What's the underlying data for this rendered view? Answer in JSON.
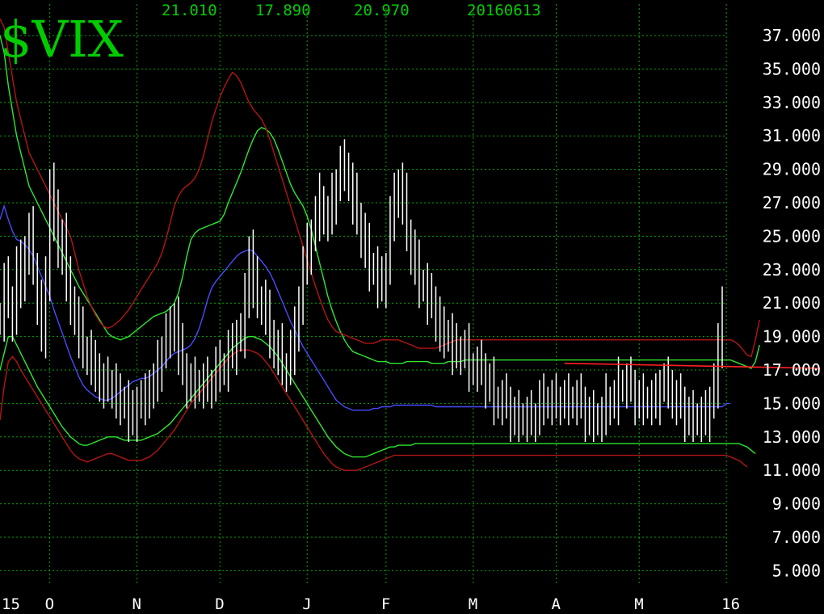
{
  "header": {
    "symbol": "$VIX",
    "high": "21.010",
    "low": "17.890",
    "close": "20.970",
    "date": "20160613"
  },
  "colors": {
    "background": "#000000",
    "grid": "#00aa00",
    "price": "#ffffff",
    "ma": "#4a4aff",
    "band_inner": "#2ee82e",
    "band_outer": "#b31515",
    "trendline": "#ff2020",
    "header_text": "#00cc00",
    "axis_text": "#ffffff"
  },
  "chart_data": {
    "type": "line",
    "title": "$VIX",
    "ylim": [
      5,
      38
    ],
    "y_ticks": [
      "37.000",
      "35.000",
      "33.000",
      "31.000",
      "29.000",
      "27.000",
      "25.000",
      "23.000",
      "21.000",
      "19.000",
      "17.000",
      "15.000",
      "13.000",
      "11.000",
      "9.000",
      "7.000",
      "5.000"
    ],
    "y_tick_values": [
      37,
      35,
      33,
      31,
      29,
      27,
      25,
      23,
      21,
      19,
      17,
      15,
      13,
      11,
      9,
      7,
      5
    ],
    "x_ticks": [
      "15",
      "O",
      "N",
      "D",
      "J",
      "F",
      "M",
      "A",
      "M",
      "16"
    ],
    "x_tick_index": [
      0,
      12,
      33,
      53,
      74,
      93,
      114,
      134,
      154,
      175
    ],
    "grid": true,
    "series": [
      {
        "style": "price",
        "values": [
          20,
          22,
          21,
          20,
          23,
          22,
          24,
          25,
          23,
          21,
          19,
          22,
          28,
          26,
          24,
          25,
          22,
          21,
          20,
          19,
          18,
          18,
          17,
          17,
          16,
          16,
          16,
          16,
          15,
          15,
          15,
          14,
          14,
          15,
          15,
          15,
          16,
          16,
          17,
          18,
          19,
          19,
          20,
          18,
          17,
          16,
          16,
          16,
          16,
          16,
          16,
          16,
          17,
          17,
          17,
          18,
          18,
          19,
          19,
          21,
          24,
          22,
          21,
          21,
          20,
          19,
          18,
          18,
          17,
          17,
          18,
          19,
          21,
          23,
          24,
          25,
          26,
          27,
          26,
          26,
          27,
          28,
          29,
          29,
          28,
          27,
          26,
          25,
          24,
          23,
          23,
          22,
          22,
          23,
          26,
          27,
          28,
          27,
          25,
          24,
          23,
          22,
          22,
          21,
          21,
          20,
          19,
          19,
          19,
          18,
          18,
          18,
          18,
          17,
          17,
          17,
          17,
          16,
          16,
          15,
          15,
          15,
          15,
          14,
          14,
          14,
          14,
          14,
          14,
          14,
          15,
          15,
          15,
          15,
          15,
          15,
          15,
          15,
          15,
          15,
          15,
          14,
          14,
          14,
          14,
          14,
          15,
          15,
          15,
          16,
          16,
          16,
          16,
          15,
          15,
          15,
          15,
          15,
          15,
          16,
          16,
          16,
          15,
          15,
          15,
          14,
          14,
          14,
          14,
          14,
          14,
          15,
          16,
          18,
          21
        ]
      },
      {
        "style": "ma",
        "values": [
          26,
          26.8,
          26,
          25.3,
          24.8,
          24.7,
          24.5,
          24.2,
          23.8,
          23.2,
          22.6,
          22,
          21.4,
          20.6,
          19.9,
          19.2,
          18.5,
          17.8,
          17.2,
          16.6,
          16.1,
          15.8,
          15.6,
          15.4,
          15.3,
          15.2,
          15.2,
          15.3,
          15.5,
          15.7,
          15.9,
          16.1,
          16.3,
          16.4,
          16.5,
          16.5,
          16.6,
          16.8,
          17,
          17.2,
          17.5,
          17.8,
          18,
          18.1,
          18.2,
          18.3,
          18.5,
          18.9,
          19.5,
          20.3,
          21.2,
          21.9,
          22.3,
          22.6,
          22.9,
          23.2,
          23.5,
          23.8,
          24,
          24.1,
          24.2,
          24.1,
          23.8,
          23.5,
          23.2,
          22.8,
          22.3,
          21.7,
          21.1,
          20.5,
          19.9,
          19.4,
          18.9,
          18.4,
          18,
          17.6,
          17.2,
          16.8,
          16.4,
          16,
          15.6,
          15.2,
          15,
          14.8,
          14.7,
          14.6,
          14.6,
          14.6,
          14.6,
          14.6,
          14.7,
          14.7,
          14.8,
          14.8,
          14.8,
          14.9,
          14.9,
          14.9,
          14.9,
          14.9,
          14.9,
          14.9,
          14.9,
          14.9,
          14.9,
          14.8,
          14.8,
          14.8,
          14.8,
          14.8,
          14.8,
          14.8,
          14.8,
          14.8,
          14.8,
          14.8,
          14.8,
          14.8,
          14.8,
          14.8,
          14.8,
          14.8,
          14.8,
          14.8,
          14.8,
          14.8,
          14.8,
          14.8,
          14.8,
          14.8,
          14.8,
          14.8,
          14.8,
          14.8,
          14.8,
          14.8,
          14.8,
          14.8,
          14.8,
          14.8,
          14.8,
          14.8,
          14.8,
          14.8,
          14.8,
          14.8,
          14.8,
          14.8,
          14.8,
          14.8,
          14.8,
          14.8,
          14.8,
          14.8,
          14.8,
          14.8,
          14.8,
          14.8,
          14.8,
          14.8,
          14.8,
          14.8,
          14.8,
          14.8,
          14.8,
          14.8,
          14.8,
          14.8,
          14.8,
          14.8,
          14.8,
          14.8,
          14.8,
          14.8,
          14.8,
          15,
          15
        ]
      },
      {
        "style": "band_inner_upper",
        "values": [
          37,
          36,
          34,
          32.5,
          31,
          30,
          29,
          28,
          27.5,
          27,
          26.5,
          26,
          25.5,
          25,
          24.5,
          24,
          23.5,
          23,
          22.5,
          22,
          21.6,
          21.2,
          20.8,
          20.4,
          20,
          19.6,
          19.2,
          19,
          18.9,
          18.8,
          18.9,
          19,
          19.2,
          19.4,
          19.6,
          19.8,
          20,
          20.2,
          20.3,
          20.4,
          20.5,
          20.7,
          21,
          21.6,
          22.6,
          23.8,
          24.8,
          25.2,
          25.4,
          25.5,
          25.6,
          25.7,
          25.8,
          25.9,
          26.3,
          27,
          27.6,
          28.2,
          28.8,
          29.5,
          30.2,
          30.8,
          31.3,
          31.5,
          31.4,
          31.2,
          30.8,
          30.2,
          29.5,
          28.8,
          28.1,
          27.6,
          27.2,
          26.8,
          26.2,
          25.4,
          24.4,
          23.4,
          22.4,
          21.4,
          20.6,
          19.9,
          19.3,
          18.8,
          18.4,
          18.1,
          18,
          17.9,
          17.8,
          17.7,
          17.6,
          17.5,
          17.5,
          17.5,
          17.4,
          17.4,
          17.4,
          17.4,
          17.5,
          17.5,
          17.5,
          17.5,
          17.5,
          17.5,
          17.4,
          17.4,
          17.4,
          17.4,
          17.5,
          17.5,
          17.5,
          17.5,
          17.6,
          17.6,
          17.6,
          17.6,
          17.6,
          17.6,
          17.6,
          17.6,
          17.6,
          17.6,
          17.6,
          17.6,
          17.6,
          17.6,
          17.6,
          17.6,
          17.6,
          17.6,
          17.6,
          17.6,
          17.6,
          17.6,
          17.6,
          17.6,
          17.6,
          17.6,
          17.6,
          17.6,
          17.6,
          17.6,
          17.6,
          17.6,
          17.6,
          17.6,
          17.6,
          17.6,
          17.6,
          17.6,
          17.6,
          17.6,
          17.6,
          17.6,
          17.6,
          17.6,
          17.6,
          17.6,
          17.6,
          17.6,
          17.6,
          17.6,
          17.6,
          17.6,
          17.6,
          17.6,
          17.6,
          17.6,
          17.6,
          17.6,
          17.6,
          17.6,
          17.6,
          17.6,
          17.6,
          17.6,
          17.6,
          17.5,
          17.4,
          17.3,
          17.2,
          17.1,
          17.5,
          18.5
        ]
      },
      {
        "style": "band_inner_lower",
        "values": [
          17,
          18,
          19,
          19,
          18.5,
          18,
          17.5,
          17,
          16.5,
          16,
          15.6,
          15.2,
          14.8,
          14.4,
          14,
          13.6,
          13.3,
          13,
          12.8,
          12.6,
          12.5,
          12.5,
          12.6,
          12.7,
          12.8,
          12.9,
          13,
          13,
          13,
          12.9,
          12.8,
          12.8,
          12.8,
          12.8,
          12.8,
          12.9,
          13,
          13.1,
          13.2,
          13.4,
          13.6,
          13.8,
          14.1,
          14.4,
          14.7,
          15,
          15.3,
          15.6,
          15.9,
          16.2,
          16.5,
          16.8,
          17.1,
          17.4,
          17.7,
          18,
          18.3,
          18.5,
          18.7,
          18.9,
          19,
          19,
          18.9,
          18.8,
          18.6,
          18.4,
          18.1,
          17.8,
          17.4,
          17,
          16.6,
          16.2,
          15.8,
          15.4,
          15,
          14.6,
          14.2,
          13.8,
          13.4,
          13,
          12.7,
          12.4,
          12.2,
          12,
          11.9,
          11.8,
          11.8,
          11.8,
          11.8,
          11.9,
          12,
          12.1,
          12.2,
          12.3,
          12.4,
          12.4,
          12.5,
          12.5,
          12.5,
          12.5,
          12.6,
          12.6,
          12.6,
          12.6,
          12.6,
          12.6,
          12.6,
          12.6,
          12.6,
          12.6,
          12.6,
          12.6,
          12.6,
          12.6,
          12.6,
          12.6,
          12.6,
          12.6,
          12.6,
          12.6,
          12.6,
          12.6,
          12.6,
          12.6,
          12.6,
          12.6,
          12.6,
          12.6,
          12.6,
          12.6,
          12.6,
          12.6,
          12.6,
          12.6,
          12.6,
          12.6,
          12.6,
          12.6,
          12.6,
          12.6,
          12.6,
          12.6,
          12.6,
          12.6,
          12.6,
          12.6,
          12.6,
          12.6,
          12.6,
          12.6,
          12.6,
          12.6,
          12.6,
          12.6,
          12.6,
          12.6,
          12.6,
          12.6,
          12.6,
          12.6,
          12.6,
          12.6,
          12.6,
          12.6,
          12.6,
          12.6,
          12.6,
          12.6,
          12.6,
          12.6,
          12.6,
          12.6,
          12.6,
          12.6,
          12.6,
          12.6,
          12.6,
          12.6,
          12.6,
          12.5,
          12.4,
          12.2,
          12
        ]
      },
      {
        "style": "band_outer_upper",
        "values": [
          38,
          37.5,
          36,
          34.5,
          33,
          32,
          31,
          30,
          29.5,
          29,
          28.5,
          28,
          27.5,
          27,
          26.5,
          26,
          25.5,
          25,
          24,
          23,
          22.2,
          21.4,
          20.8,
          20.3,
          19.9,
          19.6,
          19.5,
          19.6,
          19.8,
          20,
          20.3,
          20.6,
          21,
          21.4,
          21.8,
          22.2,
          22.6,
          23,
          23.4,
          24,
          24.8,
          25.8,
          26.8,
          27.4,
          27.8,
          28,
          28.2,
          28.5,
          29,
          29.8,
          30.8,
          31.8,
          32.6,
          33.3,
          33.9,
          34.4,
          34.8,
          34.6,
          34.2,
          33.6,
          33,
          32.6,
          32.3,
          32,
          31.5,
          30.8,
          30,
          29.2,
          28.4,
          27.6,
          26.8,
          26,
          25.2,
          24.4,
          23.6,
          22.8,
          22,
          21.3,
          20.6,
          20,
          19.6,
          19.3,
          19.2,
          19.1,
          19,
          18.9,
          18.8,
          18.7,
          18.6,
          18.6,
          18.6,
          18.7,
          18.8,
          18.8,
          18.8,
          18.8,
          18.8,
          18.7,
          18.6,
          18.5,
          18.4,
          18.3,
          18.3,
          18.3,
          18.3,
          18.3,
          18.4,
          18.5,
          18.6,
          18.7,
          18.8,
          18.8,
          18.8,
          18.8,
          18.8,
          18.8,
          18.8,
          18.8,
          18.8,
          18.8,
          18.8,
          18.8,
          18.8,
          18.8,
          18.8,
          18.8,
          18.8,
          18.8,
          18.8,
          18.8,
          18.8,
          18.8,
          18.8,
          18.8,
          18.8,
          18.8,
          18.8,
          18.8,
          18.8,
          18.8,
          18.8,
          18.8,
          18.8,
          18.8,
          18.8,
          18.8,
          18.8,
          18.8,
          18.8,
          18.8,
          18.8,
          18.8,
          18.8,
          18.8,
          18.8,
          18.8,
          18.8,
          18.8,
          18.8,
          18.8,
          18.8,
          18.8,
          18.8,
          18.8,
          18.8,
          18.8,
          18.8,
          18.8,
          18.8,
          18.8,
          18.8,
          18.8,
          18.8,
          18.8,
          18.8,
          18.8,
          18.8,
          18.7,
          18.5,
          18.2,
          17.9,
          17.8,
          18.8,
          20
        ]
      },
      {
        "style": "band_outer_lower",
        "values": [
          14,
          16,
          17.5,
          17.8,
          17.5,
          17,
          16.6,
          16.2,
          15.8,
          15.4,
          15,
          14.6,
          14.2,
          13.8,
          13.4,
          13,
          12.6,
          12.2,
          11.9,
          11.7,
          11.6,
          11.5,
          11.6,
          11.7,
          11.8,
          11.9,
          12,
          12,
          11.9,
          11.8,
          11.7,
          11.6,
          11.6,
          11.6,
          11.6,
          11.7,
          11.8,
          12,
          12.2,
          12.5,
          12.8,
          13.1,
          13.4,
          13.8,
          14.2,
          14.6,
          15,
          15.3,
          15.6,
          15.9,
          16.2,
          16.5,
          16.8,
          17.1,
          17.4,
          17.7,
          17.9,
          18.1,
          18.2,
          18.2,
          18.2,
          18.1,
          18,
          17.8,
          17.5,
          17.2,
          16.8,
          16.4,
          16,
          15.6,
          15.2,
          14.8,
          14.4,
          14,
          13.6,
          13.2,
          12.8,
          12.4,
          12,
          11.7,
          11.4,
          11.2,
          11.1,
          11,
          11,
          11,
          11,
          11.1,
          11.2,
          11.3,
          11.4,
          11.5,
          11.6,
          11.7,
          11.8,
          11.9,
          11.9,
          11.9,
          11.9,
          11.9,
          11.9,
          11.9,
          11.9,
          11.9,
          11.9,
          11.9,
          11.9,
          11.9,
          11.9,
          11.9,
          11.9,
          11.9,
          11.9,
          11.9,
          11.9,
          11.9,
          11.9,
          11.9,
          11.9,
          11.9,
          11.9,
          11.9,
          11.9,
          11.9,
          11.9,
          11.9,
          11.9,
          11.9,
          11.9,
          11.9,
          11.9,
          11.9,
          11.9,
          11.9,
          11.9,
          11.9,
          11.9,
          11.9,
          11.9,
          11.9,
          11.9,
          11.9,
          11.9,
          11.9,
          11.9,
          11.9,
          11.9,
          11.9,
          11.9,
          11.9,
          11.9,
          11.9,
          11.9,
          11.9,
          11.9,
          11.9,
          11.9,
          11.9,
          11.9,
          11.9,
          11.9,
          11.9,
          11.9,
          11.9,
          11.9,
          11.9,
          11.9,
          11.9,
          11.9,
          11.9,
          11.9,
          11.9,
          11.9,
          11.9,
          11.9,
          11.9,
          11.8,
          11.7,
          11.6,
          11.4,
          11.2
        ]
      }
    ],
    "trendline": {
      "x": [
        136,
        182
      ],
      "y": [
        17.4,
        17.1
      ]
    }
  }
}
